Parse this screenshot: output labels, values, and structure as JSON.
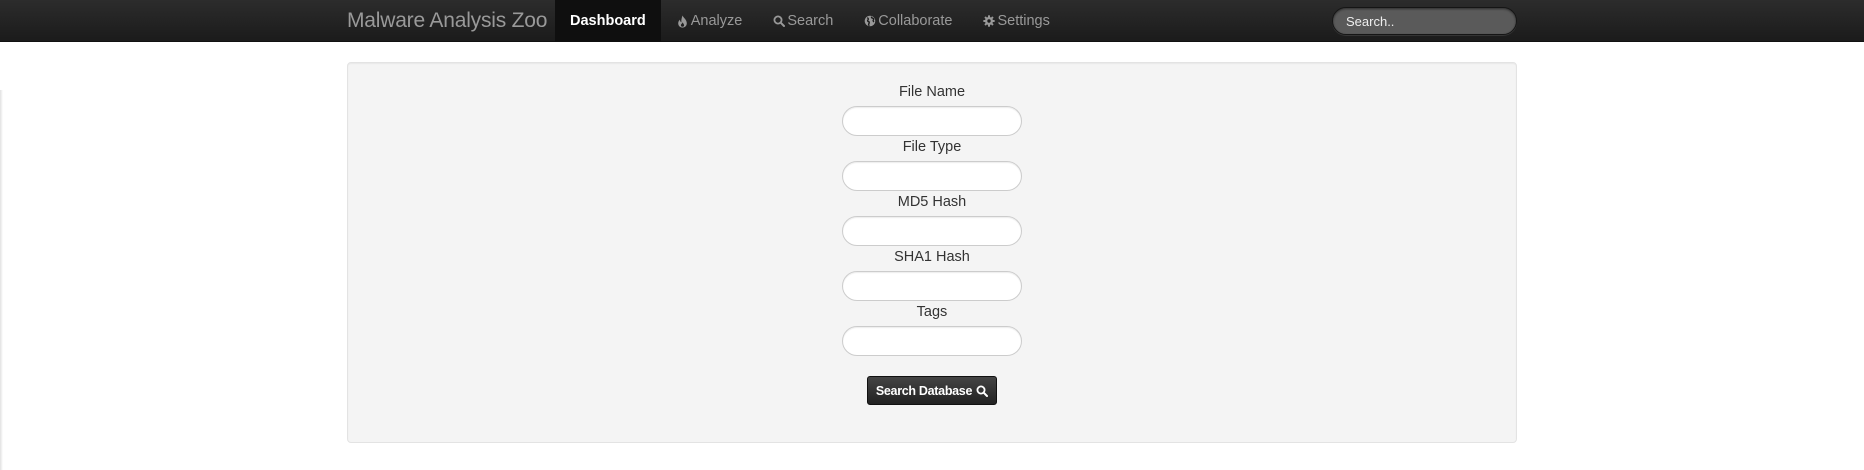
{
  "navbar": {
    "brand": "Malware Analysis Zoo",
    "items": [
      {
        "label": "Dashboard",
        "icon": "",
        "active": true
      },
      {
        "label": "Analyze",
        "icon": "fire-icon",
        "active": false
      },
      {
        "label": "Search",
        "icon": "search-icon",
        "active": false
      },
      {
        "label": "Collaborate",
        "icon": "globe-icon",
        "active": false
      },
      {
        "label": "Settings",
        "icon": "gear-icon",
        "active": false
      }
    ],
    "search": {
      "placeholder": "Search..",
      "value": ""
    }
  },
  "form": {
    "fields": [
      {
        "label": "File Name",
        "value": ""
      },
      {
        "label": "File Type",
        "value": ""
      },
      {
        "label": "MD5 Hash",
        "value": ""
      },
      {
        "label": "SHA1 Hash",
        "value": ""
      },
      {
        "label": "Tags",
        "value": ""
      }
    ],
    "submit_label": "Search Database",
    "submit_icon": "search-icon"
  },
  "colors": {
    "navbar_bg": "#1b1b1b",
    "active_tab_bg": "#0f0f0f",
    "well_bg": "#f4f4f4",
    "button_bg": "#222222"
  }
}
